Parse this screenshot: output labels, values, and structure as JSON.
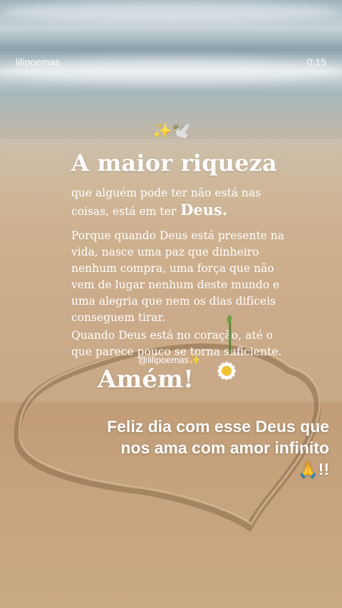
{
  "header": {
    "username": "lilipoemas",
    "duration": "0:15"
  },
  "post": {
    "emoji_top": "✨🕊️",
    "title": "A maior riqueza",
    "paragraph1": "que alguém pode ter não está nas coisas, está em ter",
    "paragraph1_emphasis": "Deus.",
    "paragraph2": "Porque quando Deus está presente na vida, nasce uma paz que dinheiro nenhum compra, uma força que não vem de lugar nenhum deste mundo e uma alegria que nem os dias difíceis conseguem tirar.",
    "paragraph3": "Quando Deus está no coração, até o que parece pouco se torna suficiente.",
    "watermark": "@lilipoemas✨",
    "amen": "Amém!",
    "greeting": "Feliz dia com esse Deus que nos ama com amor infinito 🙏!!"
  }
}
